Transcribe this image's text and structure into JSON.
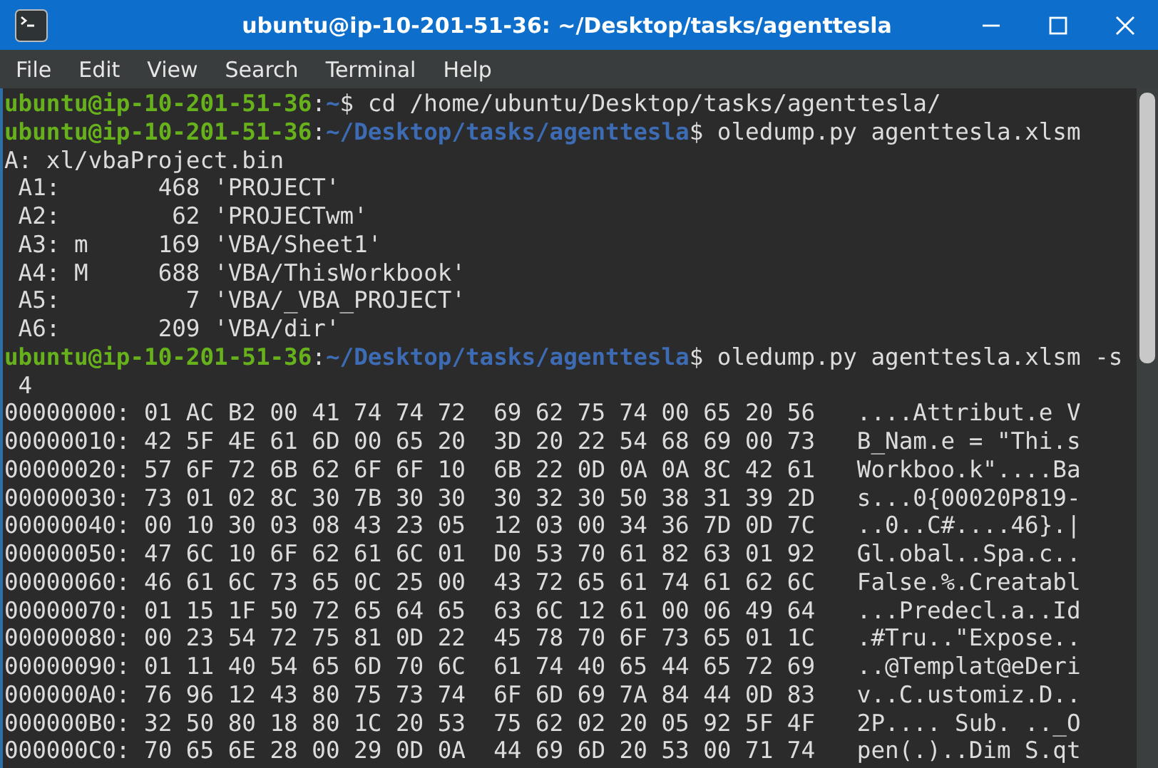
{
  "window": {
    "title": "ubuntu@ip-10-201-51-36: ~/Desktop/tasks/agenttesla"
  },
  "menu": [
    "File",
    "Edit",
    "View",
    "Search",
    "Terminal",
    "Help"
  ],
  "terminal": {
    "lines": [
      {
        "kind": "prompt",
        "host": "ubuntu@ip-10-201-51-36",
        "sep": ":",
        "cwd": "~",
        "command": "$ cd /home/ubuntu/Desktop/tasks/agenttesla/"
      },
      {
        "kind": "prompt",
        "host": "ubuntu@ip-10-201-51-36",
        "sep": ":",
        "cwd": "~/Desktop/tasks/agenttesla",
        "command": "$ oledump.py agenttesla.xlsm"
      },
      {
        "kind": "output",
        "text": "A: xl/vbaProject.bin"
      },
      {
        "kind": "output",
        "text": " A1:       468 'PROJECT'"
      },
      {
        "kind": "output",
        "text": " A2:        62 'PROJECTwm'"
      },
      {
        "kind": "output",
        "text": " A3: m     169 'VBA/Sheet1'"
      },
      {
        "kind": "output",
        "text": " A4: M     688 'VBA/ThisWorkbook'"
      },
      {
        "kind": "output",
        "text": " A5:         7 'VBA/_VBA_PROJECT'"
      },
      {
        "kind": "output",
        "text": " A6:       209 'VBA/dir'"
      },
      {
        "kind": "prompt",
        "host": "ubuntu@ip-10-201-51-36",
        "sep": ":",
        "cwd": "~/Desktop/tasks/agenttesla",
        "command": "$ oledump.py agenttesla.xlsm -s"
      },
      {
        "kind": "output",
        "text": " 4"
      },
      {
        "kind": "output",
        "text": "00000000: 01 AC B2 00 41 74 74 72  69 62 75 74 00 65 20 56   ....Attribut.e V"
      },
      {
        "kind": "output",
        "text": "00000010: 42 5F 4E 61 6D 00 65 20  3D 20 22 54 68 69 00 73   B_Nam.e = \"Thi.s"
      },
      {
        "kind": "output",
        "text": "00000020: 57 6F 72 6B 62 6F 6F 10  6B 22 0D 0A 0A 8C 42 61   Workboo.k\"....Ba"
      },
      {
        "kind": "output",
        "text": "00000030: 73 01 02 8C 30 7B 30 30  30 32 30 50 38 31 39 2D   s...0{00020P819-"
      },
      {
        "kind": "output",
        "text": "00000040: 00 10 30 03 08 43 23 05  12 03 00 34 36 7D 0D 7C   ..0..C#....46}.|"
      },
      {
        "kind": "output",
        "text": "00000050: 47 6C 10 6F 62 61 6C 01  D0 53 70 61 82 63 01 92   Gl.obal..Spa.c.."
      },
      {
        "kind": "output",
        "text": "00000060: 46 61 6C 73 65 0C 25 00  43 72 65 61 74 61 62 6C   False.%.Creatabl"
      },
      {
        "kind": "output",
        "text": "00000070: 01 15 1F 50 72 65 64 65  63 6C 12 61 00 06 49 64   ...Predecl.a..Id"
      },
      {
        "kind": "output",
        "text": "00000080: 00 23 54 72 75 81 0D 22  45 78 70 6F 73 65 01 1C   .#Tru..\"Expose.."
      },
      {
        "kind": "output",
        "text": "00000090: 01 11 40 54 65 6D 70 6C  61 74 40 65 44 65 72 69   ..@Templat@eDeri"
      },
      {
        "kind": "output",
        "text": "000000A0: 76 96 12 43 80 75 73 74  6F 6D 69 7A 84 44 0D 83   v..C.ustomiz.D.."
      },
      {
        "kind": "output",
        "text": "000000B0: 32 50 80 18 80 1C 20 53  75 62 02 20 05 92 5F 4F   2P.... Sub. .._O"
      },
      {
        "kind": "output",
        "text": "000000C0: 70 65 6E 28 00 29 0D 0A  44 69 6D 20 53 00 71 74   pen(.)..Dim S.qt"
      }
    ]
  }
}
